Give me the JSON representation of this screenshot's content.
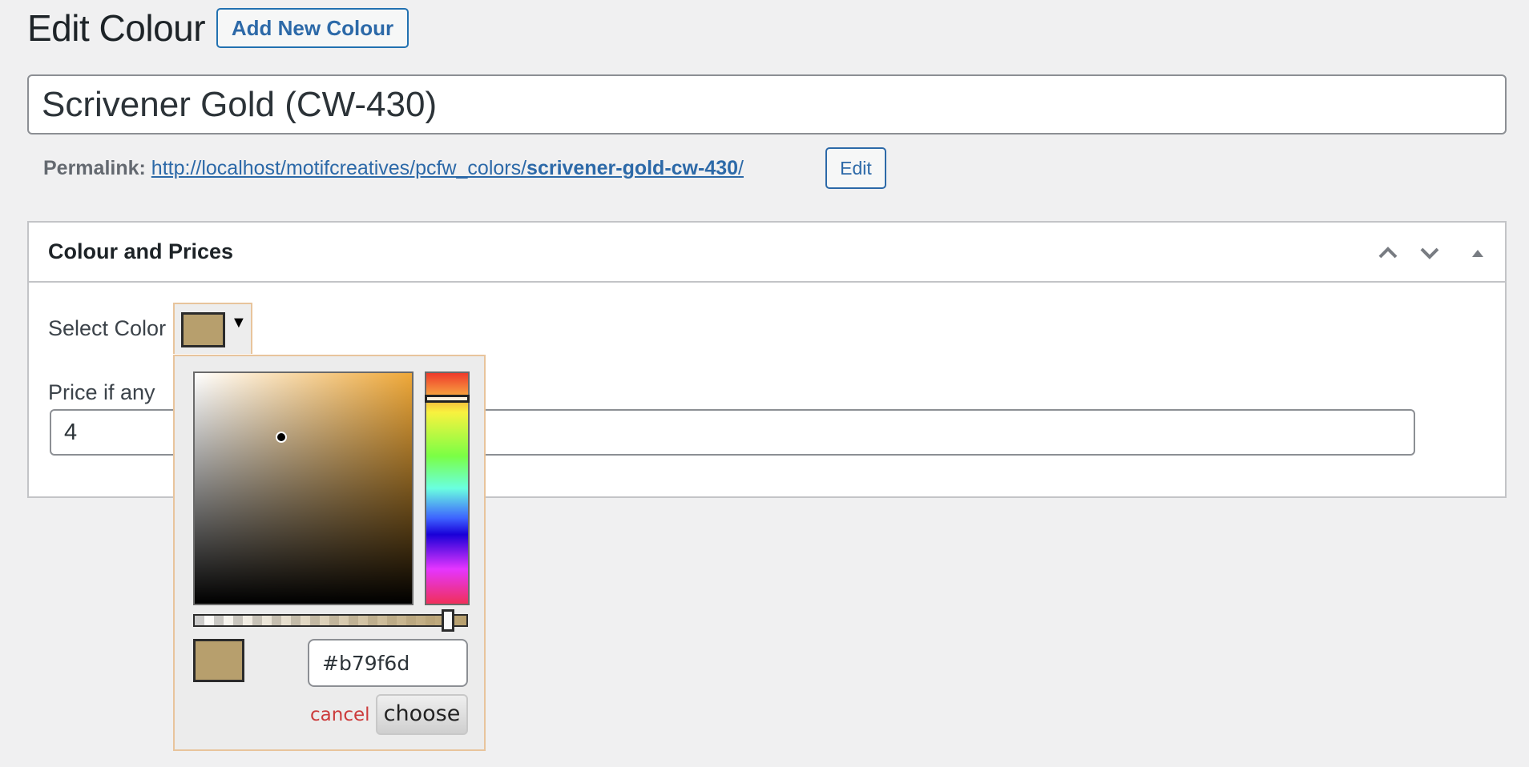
{
  "header": {
    "title": "Edit Colour",
    "add_new_label": "Add New Colour"
  },
  "post_title": {
    "value": "Scrivener Gold (CW-430)"
  },
  "permalink": {
    "label": "Permalink:",
    "base_url": "http://localhost/motifcreatives/pcfw_colors/",
    "slug": "scrivener-gold-cw-430",
    "trailing": "/",
    "edit_label": "Edit"
  },
  "metabox": {
    "title": "Colour and Prices",
    "controls": {
      "move_up_icon": "chevron-up-icon",
      "move_down_icon": "chevron-down-icon",
      "toggle_icon": "triangle-up-icon"
    },
    "select_color_label": "Select Color",
    "price_label": "Price if any",
    "price_value": "4"
  },
  "color_picker": {
    "current_color": "#b79f6d",
    "hue_color": "#efa838",
    "hex_value": "#b79f6d",
    "alpha_percent": 100,
    "cancel_label": "cancel",
    "choose_label": "choose",
    "trigger_arrow": "▼"
  }
}
